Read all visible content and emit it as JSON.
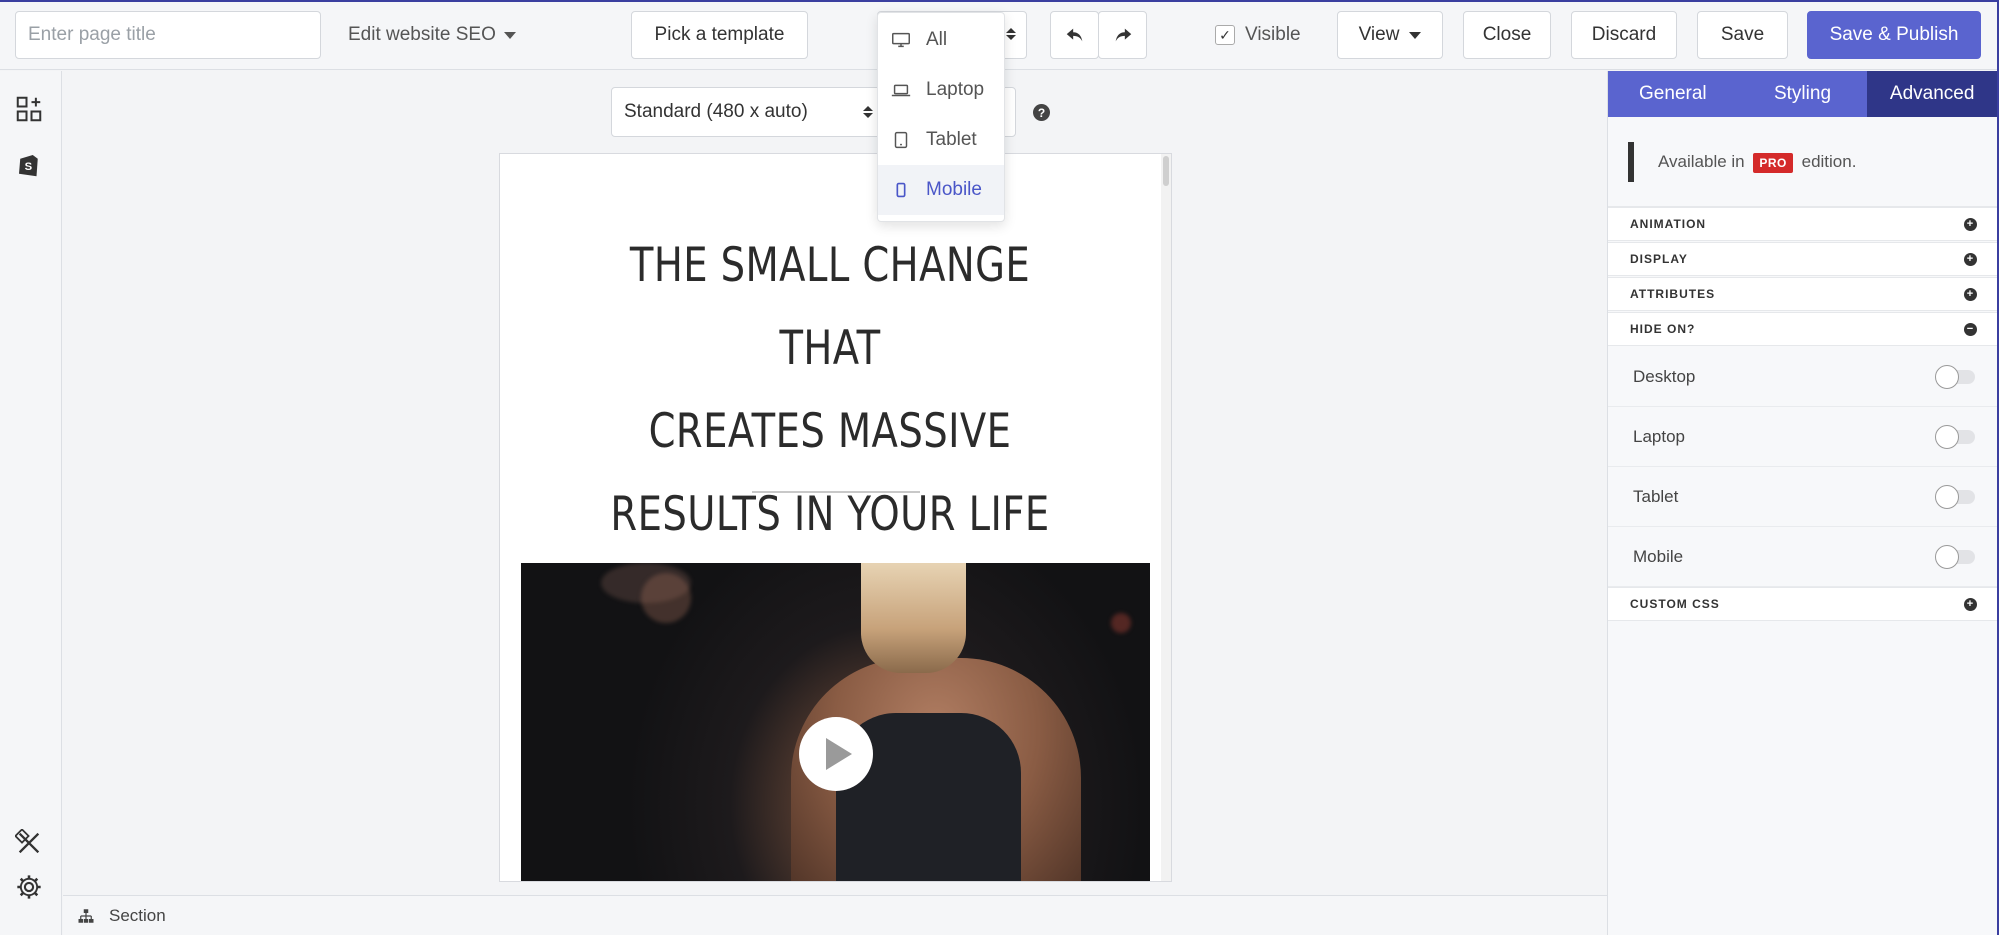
{
  "topbar": {
    "title_placeholder": "Enter page title",
    "seo_label": "Edit website SEO",
    "template_label": "Pick a template",
    "visible_label": "Visible",
    "view_label": "View",
    "close_label": "Close",
    "discard_label": "Discard",
    "save_label": "Save",
    "publish_label": "Save & Publish"
  },
  "device_menu": {
    "items": [
      {
        "label": "All",
        "icon": "desktop-icon"
      },
      {
        "label": "Laptop",
        "icon": "laptop-icon"
      },
      {
        "label": "Tablet",
        "icon": "tablet-icon"
      },
      {
        "label": "Mobile",
        "icon": "mobile-icon",
        "active": true
      }
    ]
  },
  "canvas": {
    "size_label": "Standard (480 x auto)",
    "help": "?",
    "headline": [
      "THE SMALL CHANGE THAT",
      "CREATES MASSIVE",
      "RESULTS IN YOUR LIFE"
    ]
  },
  "bottom": {
    "breadcrumb": "Section"
  },
  "right_panel": {
    "tabs": [
      "General",
      "Styling",
      "Advanced"
    ],
    "active_tab": "Advanced",
    "pro_note": {
      "before": "Available in",
      "badge": "PRO",
      "after": "edition."
    },
    "sections": {
      "animation": "ANIMATION",
      "display": "DISPLAY",
      "attributes": "ATTRIBUTES",
      "hide_on": "HIDE ON?",
      "custom_css": "CUSTOM CSS"
    },
    "hide_on_items": [
      "Desktop",
      "Laptop",
      "Tablet",
      "Mobile"
    ]
  },
  "colors": {
    "accent": "#5a64cf",
    "accent_dark": "#2f3688",
    "pro_red": "#d42a2a"
  }
}
